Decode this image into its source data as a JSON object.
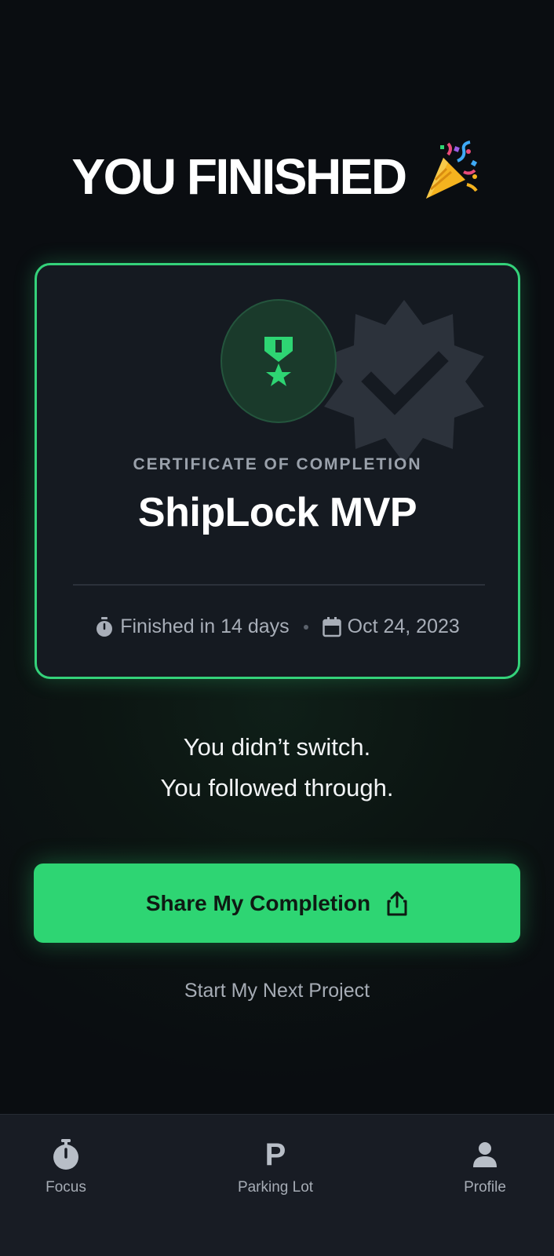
{
  "header": {
    "title": "YOU FINISHED",
    "emoji_icon": "party-popper-icon"
  },
  "certificate": {
    "label": "CERTIFICATE OF COMPLETION",
    "project_name": "ShipLock MVP",
    "duration": "Finished in 14 days",
    "date": "Oct 24, 2023",
    "medal_icon": "medal-icon",
    "badge_icon": "verified-badge-icon"
  },
  "message": {
    "line1": "You didn’t switch.",
    "line2": "You followed through."
  },
  "actions": {
    "share_label": "Share My Completion",
    "share_icon": "share-icon",
    "next_label": "Start My Next Project"
  },
  "nav": {
    "items": [
      {
        "label": "Focus",
        "icon": "stopwatch-icon"
      },
      {
        "label": "Parking Lot",
        "icon": "parking-icon",
        "glyph": "P"
      },
      {
        "label": "Profile",
        "icon": "person-icon"
      }
    ]
  },
  "colors": {
    "accent": "#2ed573",
    "card_border": "#34d27a",
    "background": "#0b0e12",
    "card": "#151a21"
  }
}
